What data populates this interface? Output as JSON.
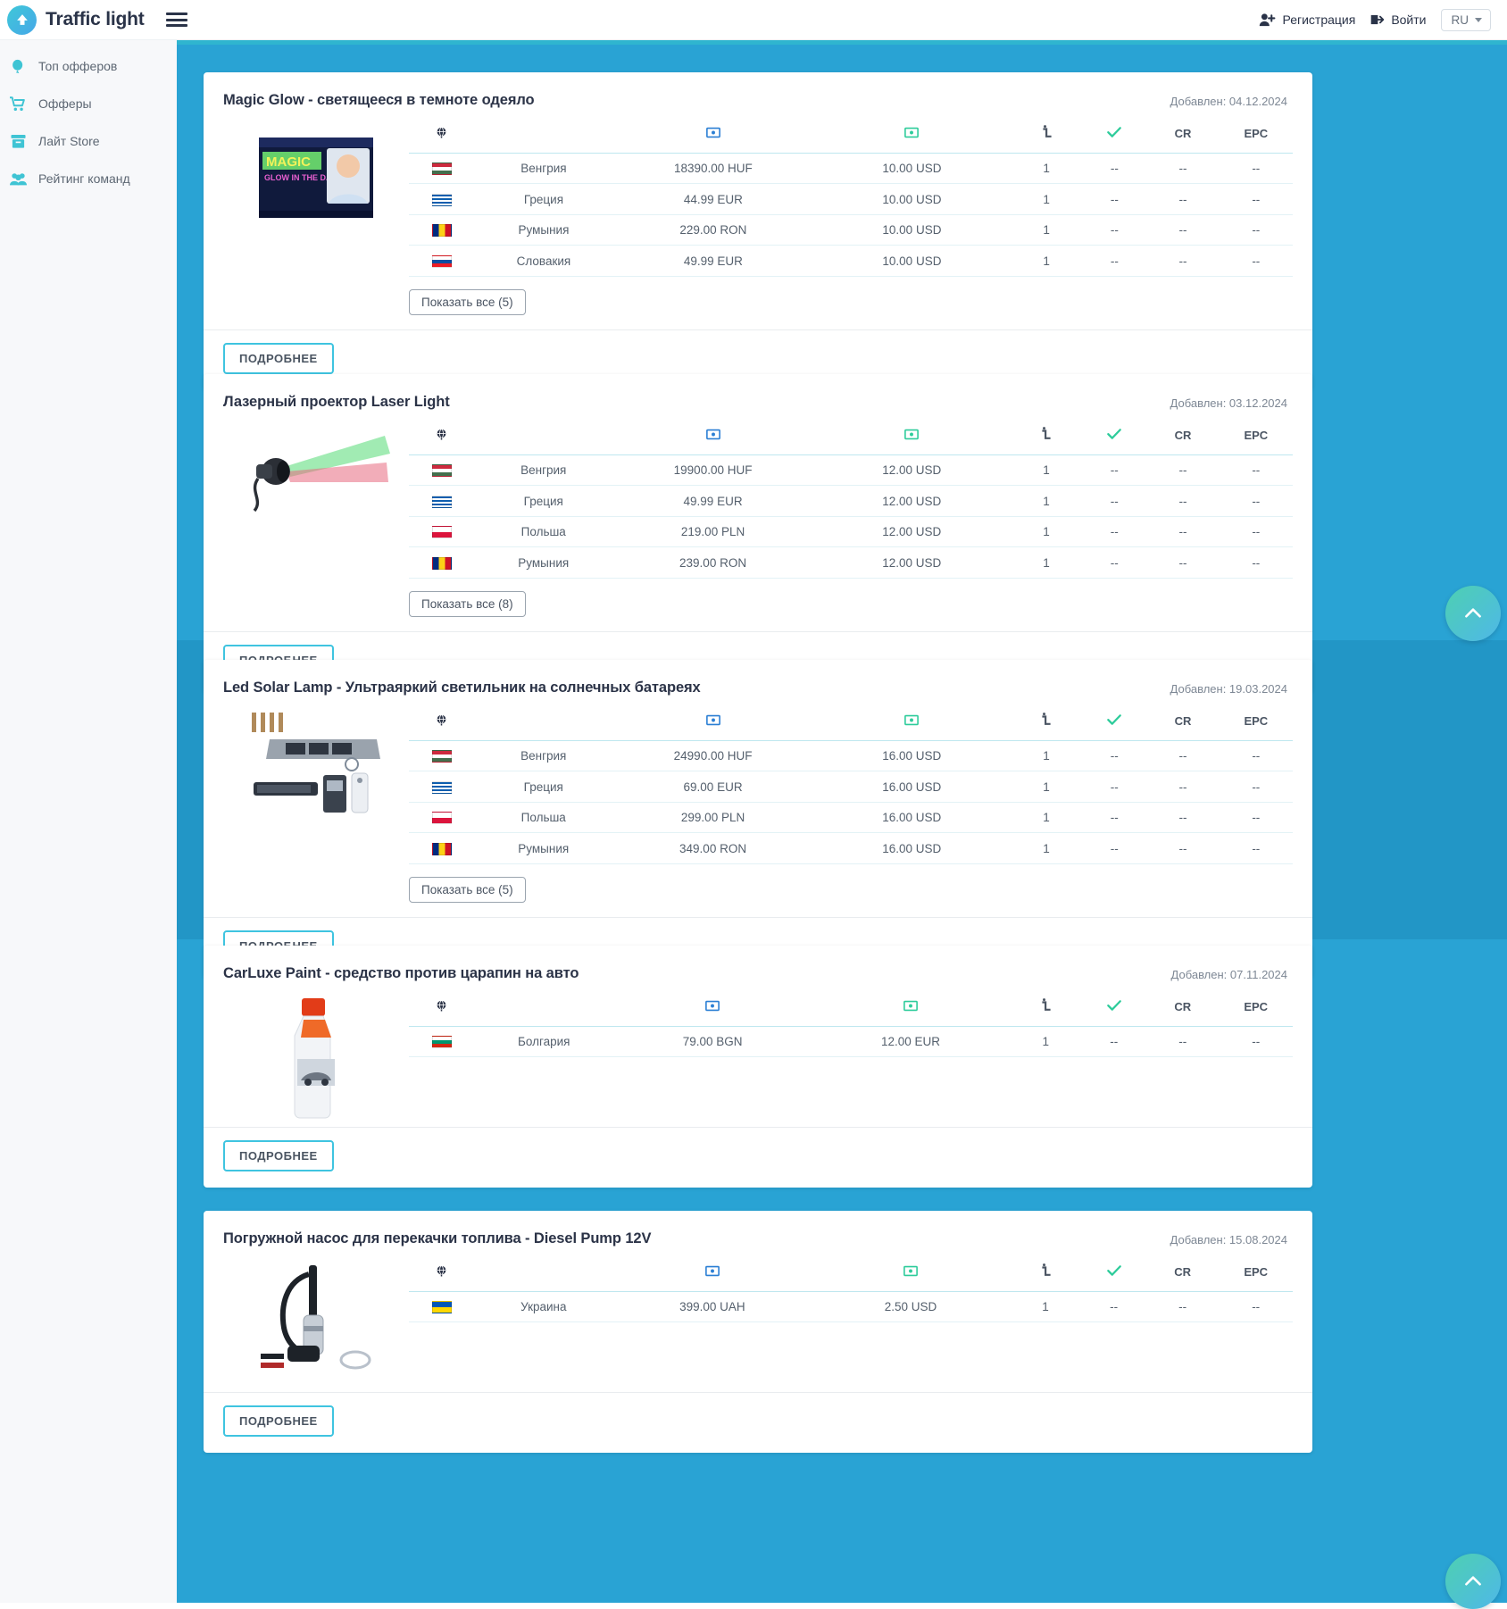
{
  "header": {
    "brand": "Traffic light",
    "logo_icon": "arrow-up-circle-icon",
    "menu_icon": "hamburger-menu-icon",
    "register_label": "Регистрация",
    "register_icon": "user-plus-icon",
    "login_label": "Войти",
    "login_icon": "sign-in-icon",
    "language": "RU",
    "language_caret_icon": "chevron-down-icon"
  },
  "sidebar": {
    "items": [
      {
        "label": "Топ офферов",
        "icon": "balloon-icon"
      },
      {
        "label": "Офферы",
        "icon": "shopping-cart-icon"
      },
      {
        "label": "Лайт Store",
        "icon": "archive-box-icon"
      },
      {
        "label": "Рейтинг команд",
        "icon": "users-group-icon"
      }
    ]
  },
  "colors": {
    "page_background": "#29a3d4",
    "page_background_hover": "#2296c6",
    "accent": "#3fc4e0",
    "title": "#2b3347",
    "header_strip": "#2fb5cf"
  },
  "table": {
    "columns": [
      {
        "key": "flag",
        "header_icon": "globe-icon",
        "label": ""
      },
      {
        "key": "country",
        "header_icon": "",
        "label": ""
      },
      {
        "key": "price",
        "header_icon": "banknote-blue-icon",
        "label": ""
      },
      {
        "key": "payout",
        "header_icon": "banknote-green-icon",
        "label": ""
      },
      {
        "key": "hold",
        "header_icon": "hold-time-icon",
        "label": ""
      },
      {
        "key": "approve",
        "header_icon": "check-icon",
        "label": ""
      },
      {
        "key": "cr",
        "header_icon": "",
        "label": "CR"
      },
      {
        "key": "epc",
        "header_icon": "",
        "label": "EPC"
      }
    ],
    "date_prefix": "Добавлен:",
    "details_label": "ПОДРОБНЕЕ"
  },
  "offers": [
    {
      "title": "Magic Glow - светящееся в темноте одеяло",
      "date": "Добавлен: 04.12.2024",
      "thumb": "magic-glow-blanket-box",
      "show_all_label": "Показать все (5)",
      "details_label": "ПОДРОБНЕЕ",
      "rows": [
        {
          "flag": "f-hu",
          "country": "Венгрия",
          "price": "18390.00 HUF",
          "payout": "10.00 USD",
          "hold": "1",
          "approve": "--",
          "cr": "--",
          "epc": "--"
        },
        {
          "flag": "f-gr",
          "country": "Греция",
          "price": "44.99 EUR",
          "payout": "10.00 USD",
          "hold": "1",
          "approve": "--",
          "cr": "--",
          "epc": "--"
        },
        {
          "flag": "f-ro",
          "country": "Румыния",
          "price": "229.00 RON",
          "payout": "10.00 USD",
          "hold": "1",
          "approve": "--",
          "cr": "--",
          "epc": "--"
        },
        {
          "flag": "f-sk",
          "country": "Словакия",
          "price": "49.99 EUR",
          "payout": "10.00 USD",
          "hold": "1",
          "approve": "--",
          "cr": "--",
          "epc": "--"
        }
      ]
    },
    {
      "title": "Лазерный проектор Laser Light",
      "date": "Добавлен: 03.12.2024",
      "thumb": "laser-projector",
      "show_all_label": "Показать все (8)",
      "details_label": "ПОДРОБНЕЕ",
      "rows": [
        {
          "flag": "f-hu",
          "country": "Венгрия",
          "price": "19900.00 HUF",
          "payout": "12.00 USD",
          "hold": "1",
          "approve": "--",
          "cr": "--",
          "epc": "--"
        },
        {
          "flag": "f-gr",
          "country": "Греция",
          "price": "49.99 EUR",
          "payout": "12.00 USD",
          "hold": "1",
          "approve": "--",
          "cr": "--",
          "epc": "--"
        },
        {
          "flag": "f-pl",
          "country": "Польша",
          "price": "219.00 PLN",
          "payout": "12.00 USD",
          "hold": "1",
          "approve": "--",
          "cr": "--",
          "epc": "--"
        },
        {
          "flag": "f-ro",
          "country": "Румыния",
          "price": "239.00 RON",
          "payout": "12.00 USD",
          "hold": "1",
          "approve": "--",
          "cr": "--",
          "epc": "--"
        }
      ]
    },
    {
      "title": "Led Solar Lamp - Ультраяркий светильник на солнечных батареях",
      "date": "Добавлен: 19.03.2024",
      "thumb": "solar-street-lamp",
      "show_all_label": "Показать все (5)",
      "details_label": "ПОДРОБНЕЕ",
      "rows": [
        {
          "flag": "f-hu",
          "country": "Венгрия",
          "price": "24990.00 HUF",
          "payout": "16.00 USD",
          "hold": "1",
          "approve": "--",
          "cr": "--",
          "epc": "--"
        },
        {
          "flag": "f-gr",
          "country": "Греция",
          "price": "69.00 EUR",
          "payout": "16.00 USD",
          "hold": "1",
          "approve": "--",
          "cr": "--",
          "epc": "--"
        },
        {
          "flag": "f-pl",
          "country": "Польша",
          "price": "299.00 PLN",
          "payout": "16.00 USD",
          "hold": "1",
          "approve": "--",
          "cr": "--",
          "epc": "--"
        },
        {
          "flag": "f-ro",
          "country": "Румыния",
          "price": "349.00 RON",
          "payout": "16.00 USD",
          "hold": "1",
          "approve": "--",
          "cr": "--",
          "epc": "--"
        }
      ]
    },
    {
      "title": "CarLuxe Paint - средство против царапин на авто",
      "date": "Добавлен: 07.11.2024",
      "thumb": "carluxe-paint-bottle",
      "show_all_label": "",
      "details_label": "ПОДРОБНЕЕ",
      "rows": [
        {
          "flag": "f-bg",
          "country": "Болгария",
          "price": "79.00 BGN",
          "payout": "12.00 EUR",
          "hold": "1",
          "approve": "--",
          "cr": "--",
          "epc": "--"
        }
      ]
    },
    {
      "title": "Погружной насос для перекачки топлива - Diesel Pump 12V",
      "date": "Добавлен: 15.08.2024",
      "thumb": "diesel-pump",
      "show_all_label": "",
      "details_label": "ПОДРОБНЕЕ",
      "rows": [
        {
          "flag": "f-ua",
          "country": "Украина",
          "price": "399.00 UAH",
          "payout": "2.50 USD",
          "hold": "1",
          "approve": "--",
          "cr": "--",
          "epc": "--"
        }
      ]
    }
  ],
  "scroll_top": {
    "icon": "chevron-up-icon",
    "count": 2
  }
}
